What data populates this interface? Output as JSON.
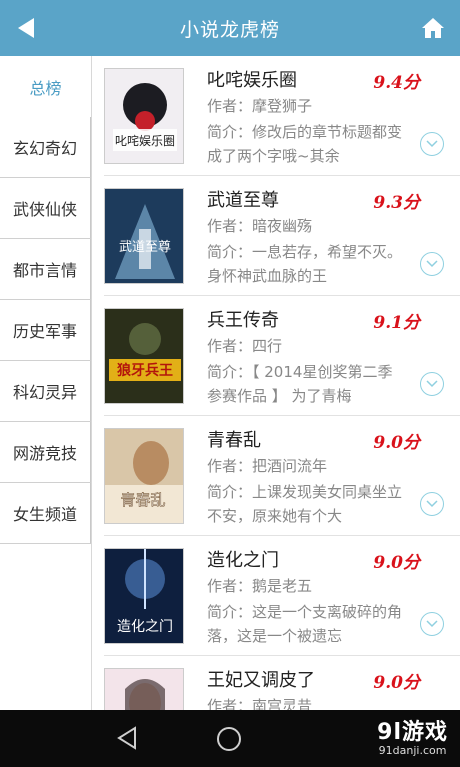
{
  "header": {
    "title": "小说龙虎榜"
  },
  "sidebar": {
    "items": [
      {
        "label": "总榜"
      },
      {
        "label": "玄幻奇幻"
      },
      {
        "label": "武侠仙侠"
      },
      {
        "label": "都市言情"
      },
      {
        "label": "历史军事"
      },
      {
        "label": "科幻灵异"
      },
      {
        "label": "网游竞技"
      },
      {
        "label": "女生频道"
      }
    ]
  },
  "books": [
    {
      "name": "叱咤娱乐圈",
      "score": "9.4分",
      "author": "作者：摩登狮子",
      "intro": "简介：修改后的章节标题都变成了两个字哦~其余",
      "cover_title": "叱咤娱乐圈"
    },
    {
      "name": "武道至尊",
      "score": "9.3分",
      "author": "作者：暗夜幽殇",
      "intro": "简介：一息若存，希望不灭。 身怀神武血脉的王",
      "cover_title": "武道至尊"
    },
    {
      "name": "兵王传奇",
      "score": "9.1分",
      "author": "作者：四行",
      "intro": "简介：【 2014星创奖第二季参赛作品 】 为了青梅",
      "cover_title": "狼牙兵王"
    },
    {
      "name": "青春乱",
      "score": "9.0分",
      "author": "作者：把酒问流年",
      "intro": "简介：上课发现美女同桌坐立不安，原来她有个大",
      "cover_title": "青春乱"
    },
    {
      "name": "造化之门",
      "score": "9.0分",
      "author": "作者：鹅是老五",
      "intro": "简介：这是一个支离破碎的角落，这是一个被遗忘",
      "cover_title": "造化之门"
    },
    {
      "name": "王妃又调皮了",
      "score": "9.0分",
      "author": "作者：南宫灵昔",
      "intro": "",
      "cover_title": ""
    }
  ],
  "watermark": {
    "main": "9l游戏",
    "sub": "91danji.com"
  },
  "colors": {
    "header_bg": "#5aa4c8",
    "score": "#d9121b",
    "active_tab": "#4a9cc4"
  }
}
